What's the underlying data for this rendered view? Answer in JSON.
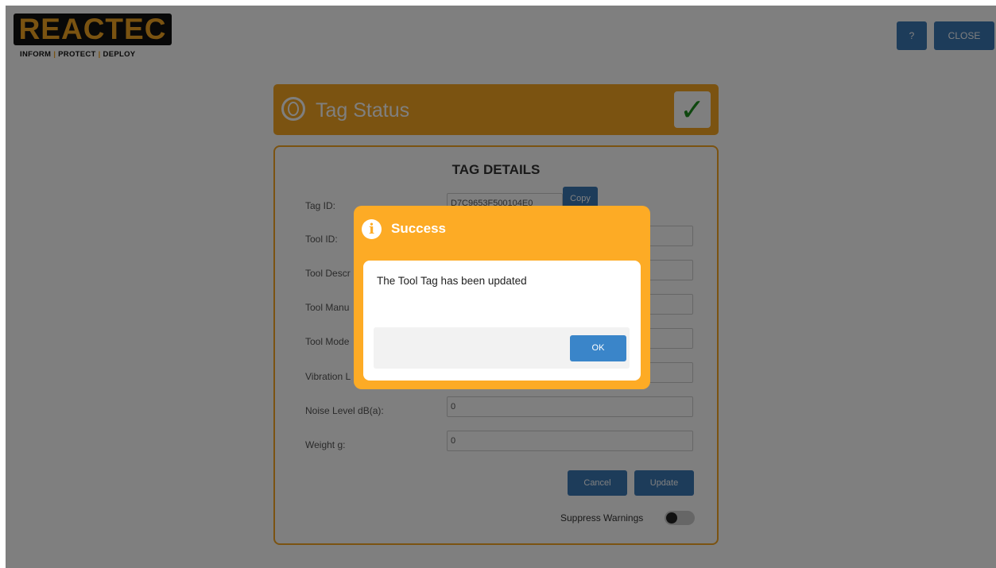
{
  "header": {
    "logo_text": "REACTEC",
    "tagline": [
      "INFORM",
      "PROTECT",
      "DEPLOY"
    ],
    "help_label": "?",
    "close_label": "CLOSE"
  },
  "status": {
    "title": "Tag Status",
    "check_icon": "check-icon",
    "check_glyph": "✓"
  },
  "details": {
    "title": "TAG DETAILS",
    "fields": [
      {
        "label": "Tag ID:",
        "value": "D7C9653F500104E0"
      },
      {
        "label": "Tool ID:",
        "value": ""
      },
      {
        "label": "Tool Descr",
        "value": ""
      },
      {
        "label": "Tool Manu",
        "value": ""
      },
      {
        "label": "Tool Mode",
        "value": ""
      },
      {
        "label": "Vibration L",
        "value": ""
      },
      {
        "label": "Noise Level dB(a):",
        "value": "0"
      },
      {
        "label": "Weight g:",
        "value": "0"
      }
    ],
    "copy_label": "Copy",
    "cancel_label": "Cancel",
    "update_label": "Update",
    "suppress_label": "Suppress Warnings",
    "suppress_on": false
  },
  "modal": {
    "title": "Success",
    "icon": "info-icon",
    "icon_glyph": "i",
    "message": "The Tool Tag has been updated",
    "ok_label": "OK"
  },
  "colors": {
    "accent_orange": "#f6a623",
    "modal_orange": "#fdab25",
    "button_blue": "#3a78b5",
    "check_green": "#1f8f1f"
  }
}
